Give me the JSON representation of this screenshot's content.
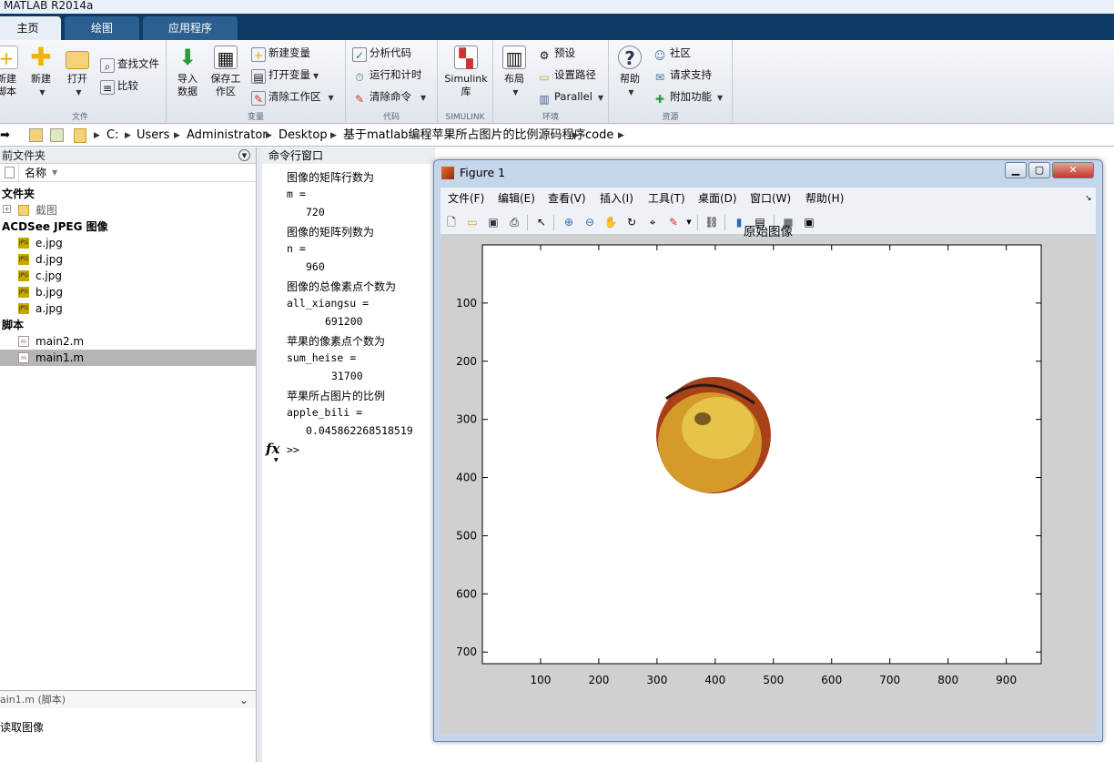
{
  "app": {
    "title": "MATLAB R2014a"
  },
  "tabs": [
    {
      "label": "主页"
    },
    {
      "label": "绘图"
    },
    {
      "label": "应用程序"
    }
  ],
  "ribbon": {
    "file": {
      "label": "文件",
      "new_script": "新建脚本",
      "new": "新建",
      "open": "打开",
      "find_files": "查找文件",
      "compare": "比较"
    },
    "variable": {
      "label": "变量",
      "import_data": "导入数据",
      "save_workspace": "保存工作区",
      "new_variable": "新建变量",
      "open_variable": "打开变量",
      "clear_workspace": "清除工作区"
    },
    "code": {
      "label": "代码",
      "analyze_code": "分析代码",
      "run_and_time": "运行和计时",
      "clear_commands": "清除命令"
    },
    "simulink": {
      "label": "SIMULINK",
      "simulink_library": "Simulink 库"
    },
    "environment": {
      "label": "环境",
      "layout": "布局",
      "preferences": "预设",
      "set_path": "设置路径",
      "parallel": "Parallel"
    },
    "resources": {
      "label": "资源",
      "help": "帮助",
      "community": "社区",
      "request_support": "请求支持",
      "addons": "附加功能"
    }
  },
  "address": {
    "path": [
      "C:",
      "Users",
      "Administrator",
      "Desktop",
      "基于matlab编程苹果所占图片的比例源码程序",
      "code"
    ]
  },
  "current_folder": {
    "title": "前文件夹",
    "col_name": "名称",
    "cat_folder": "文件夹",
    "folders": [
      "截图"
    ],
    "cat_jpeg": "ACDSee JPEG 图像",
    "jpegs": [
      "e.jpg",
      "d.jpg",
      "c.jpg",
      "b.jpg",
      "a.jpg"
    ],
    "cat_script": "脚本",
    "scripts": [
      "main2.m",
      "main1.m"
    ],
    "selected": "main1.m",
    "details_title": "ain1.m (脚本)",
    "details_text": "读取图像"
  },
  "command_window": {
    "title": "命令行窗口",
    "lines": [
      {
        "text": "图像的矩阵行数为",
        "mono": false,
        "indent": 0
      },
      {
        "text": "m =",
        "mono": true,
        "indent": 0
      },
      {
        "text": "720",
        "mono": true,
        "indent": 21
      },
      {
        "text": "图像的矩阵列数为",
        "mono": false,
        "indent": 0
      },
      {
        "text": "n =",
        "mono": true,
        "indent": 0
      },
      {
        "text": "960",
        "mono": true,
        "indent": 21
      },
      {
        "text": "图像的总像素点个数为",
        "mono": false,
        "indent": 0
      },
      {
        "text": "all_xiangsu =",
        "mono": true,
        "indent": 0
      },
      {
        "text": "691200",
        "mono": true,
        "indent": 42
      },
      {
        "text": "苹果的像素点个数为",
        "mono": false,
        "indent": 0
      },
      {
        "text": "sum_heise =",
        "mono": true,
        "indent": 0
      },
      {
        "text": "31700",
        "mono": true,
        "indent": 49
      },
      {
        "text": "苹果所占图片的比例",
        "mono": false,
        "indent": 0
      },
      {
        "text": "apple_bili =",
        "mono": true,
        "indent": 0
      },
      {
        "text": "0.045862268518519",
        "mono": true,
        "indent": 21
      }
    ],
    "fx": "fx",
    "prompt": ">>"
  },
  "figure": {
    "title": "Figure 1",
    "menu": [
      "文件(F)",
      "编辑(E)",
      "查看(V)",
      "插入(I)",
      "工具(T)",
      "桌面(D)",
      "窗口(W)",
      "帮助(H)"
    ],
    "plot_title": "原始图像",
    "x_ticks": [
      "100",
      "200",
      "300",
      "400",
      "500",
      "600",
      "700",
      "800",
      "900"
    ],
    "y_ticks": [
      "100",
      "200",
      "300",
      "400",
      "500",
      "600",
      "700"
    ]
  },
  "colors": {
    "tab_bar": "#0e3b66",
    "selected_row": "#b5b5b5",
    "figure_frame": "#c6d6ea"
  }
}
